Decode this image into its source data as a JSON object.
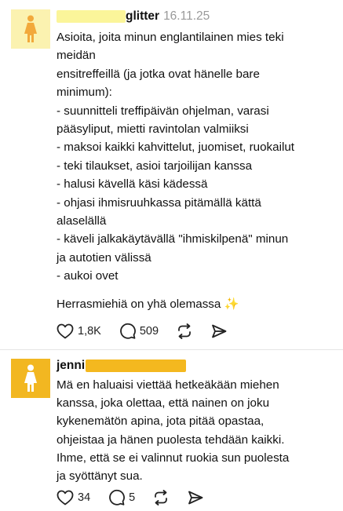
{
  "posts": [
    {
      "username": "glitter",
      "timestamp": "16.11.25",
      "avatar_color": "#fbf2b0",
      "avatar_figure_color": "#f2a93b",
      "redaction_color": "#fbf59a",
      "lines": [
        "Asioita, joita minun englantilainen mies teki",
        "meidän",
        "ensitreffeillä (ja jotka ovat hänelle bare",
        "minimum):",
        "- suunnitteli treffipäivän ohjelman, varasi",
        "pääsyliput, mietti ravintolan valmiiksi",
        "- maksoi kaikki kahvittelut, juomiset, ruokailut",
        "- teki tilaukset, asioi tarjoilijan kanssa",
        "- halusi kävellä käsi kädessä",
        "- ohjasi ihmisruuhkassa pitämällä kättä",
        "alaselällä",
        "- käveli jalkakäytävällä \"ihmiskilpenä\" minun",
        "ja autotien välissä",
        "- aukoi ovet"
      ],
      "closing_line": "Herrasmiehiä on yhä olemassa",
      "closing_emoji": "✨",
      "likes": "1,8K",
      "comments": "509"
    },
    {
      "username": "jenni",
      "avatar_color": "#f2b721",
      "avatar_figure_color": "#ffffff",
      "redaction_color": "#f4b81f",
      "lines": [
        "Mä en haluaisi viettää hetkeäkään miehen",
        "kanssa, joka olettaa, että nainen on joku",
        "kykenemätön apina, jota pitää opastaa,",
        "ohjeistaa ja hänen puolesta tehdään kaikki.",
        "Ihme, että se ei valinnut ruokia sun puolesta",
        "ja syöttänyt sua."
      ],
      "likes": "34",
      "comments": "5"
    }
  ],
  "icons": {
    "like": "heart-icon",
    "comment": "speech-bubble-icon",
    "repost": "repost-icon",
    "share": "send-icon",
    "avatar": "woman-figure-icon"
  }
}
